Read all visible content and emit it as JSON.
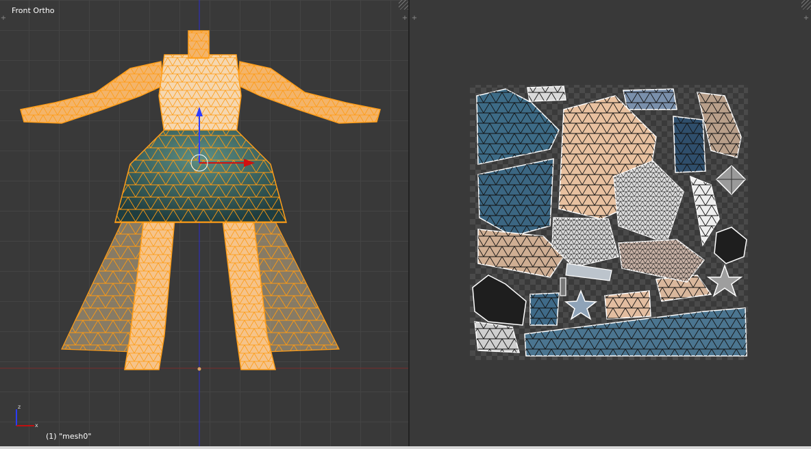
{
  "viewport_3d": {
    "view_label": "Front Ortho",
    "object_label": "(1) \"mesh0\"",
    "axis_labels": {
      "z": "z",
      "x": "x"
    }
  },
  "uv_editor": {},
  "icons": [
    "area-split-plus-icon",
    "area-corner-hatch-icon",
    "axis-gizmo-icon",
    "3d-cursor-icon"
  ],
  "colors": {
    "viewport_bg": "#393939",
    "wire_selected": "#ff9e1a",
    "skin": "#f5c38a",
    "dress": "#2f5a5c",
    "axis_blue": "#1f2bd6",
    "axis_red": "#b01010"
  }
}
